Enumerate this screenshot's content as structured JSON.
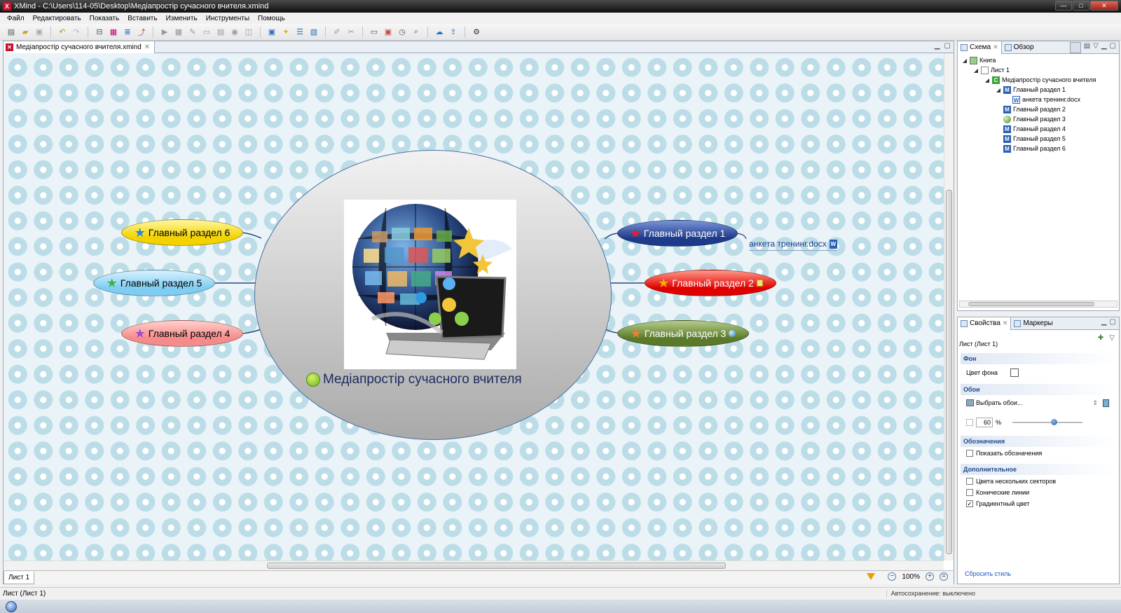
{
  "window": {
    "title": "XMind - C:\\Users\\114-05\\Desktop\\Медіапростір сучасного вчителя.xmind",
    "buttons": [
      "—",
      "□",
      "✕"
    ]
  },
  "menu": [
    "Файл",
    "Редактировать",
    "Показать",
    "Вставить",
    "Изменить",
    "Инструменты",
    "Помощь"
  ],
  "toolbar": {
    "icons": [
      "new-file-icon",
      "open-folder-icon",
      "save-icon",
      "undo-icon",
      "redo-icon",
      "insert-topic-icon",
      "subtopic-icon",
      "relationship-icon",
      "boundary-icon",
      "presentation-icon",
      "image-icon",
      "attachment-icon",
      "note-icon",
      "label-icon",
      "marker-icon",
      "hyperlink-icon",
      "idea-icon",
      "layout-icon",
      "gantt-icon",
      "brush-icon",
      "format-icon",
      "outline-view-icon",
      "map-view-icon",
      "clock-icon",
      "zoom-fit-icon",
      "cloud-upload-icon",
      "share-icon",
      "settings-gear-icon"
    ]
  },
  "editor": {
    "tab_label": "Медіапростір сучасного вчителя.xmind",
    "sheet_tab": "Лист 1",
    "zoom": "100%"
  },
  "mindmap": {
    "central_topic": "Медіапростір сучасного вчителя",
    "branches": [
      {
        "label": "Главный раздел 1",
        "color": "#1e3a8a",
        "marker": "red-star"
      },
      {
        "label": "Главный раздел 2",
        "color": "#e00000",
        "marker": "orange-star"
      },
      {
        "label": "Главный раздел 3",
        "color": "#5a7a2a",
        "marker": "orange-star"
      },
      {
        "label": "Главный раздел 4",
        "color": "#f58b8a",
        "marker": "purple-star"
      },
      {
        "label": "Главный раздел 5",
        "color": "#7fcdf2",
        "marker": "green-star"
      },
      {
        "label": "Главный раздел 6",
        "color": "#f3d200",
        "marker": "blue-star"
      }
    ],
    "subtopic": "анкета тренинг.docx"
  },
  "outline": {
    "tabs": [
      "Схема",
      "Обзор"
    ],
    "tree": [
      {
        "label": "Книга",
        "level": 0
      },
      {
        "label": "Лист 1",
        "level": 1
      },
      {
        "label": "Медіапростір сучасного вчителя",
        "level": 2
      },
      {
        "label": "Главный раздел 1",
        "level": 3
      },
      {
        "label": "анкета тренинг.docx",
        "level": 4
      },
      {
        "label": "Главный раздел 2",
        "level": 3
      },
      {
        "label": "Главный раздел 3",
        "level": 3
      },
      {
        "label": "Главный раздел 4",
        "level": 3
      },
      {
        "label": "Главный раздел 5",
        "level": 3
      },
      {
        "label": "Главный раздел 6",
        "level": 3
      }
    ]
  },
  "properties": {
    "tabs": [
      "Свойства",
      "Маркеры"
    ],
    "title": "Лист (Лист 1)",
    "sections": {
      "background": "Фон",
      "background_color_label": "Цвет фона",
      "wallpaper": "Обои",
      "choose_wallpaper": "Выбрать обои...",
      "opacity_value": "60",
      "opacity_unit": "%",
      "opacity_fraction": 0.6,
      "legend": "Обозначения",
      "show_legend": "Показать обозначения",
      "advanced": "Дополнительное",
      "multi_sector_colors": "Цвета нескольких секторов",
      "tapered_lines": "Конические линии",
      "gradient_color": "Градиентный цвет"
    },
    "checks": {
      "show_legend": false,
      "multi_sector_colors": false,
      "tapered_lines": false,
      "gradient_color": true
    },
    "reset_style": "Сбросить стиль"
  },
  "status": {
    "left": "Лист (Лист 1)",
    "autosave": "Автосохранение: выключено"
  }
}
